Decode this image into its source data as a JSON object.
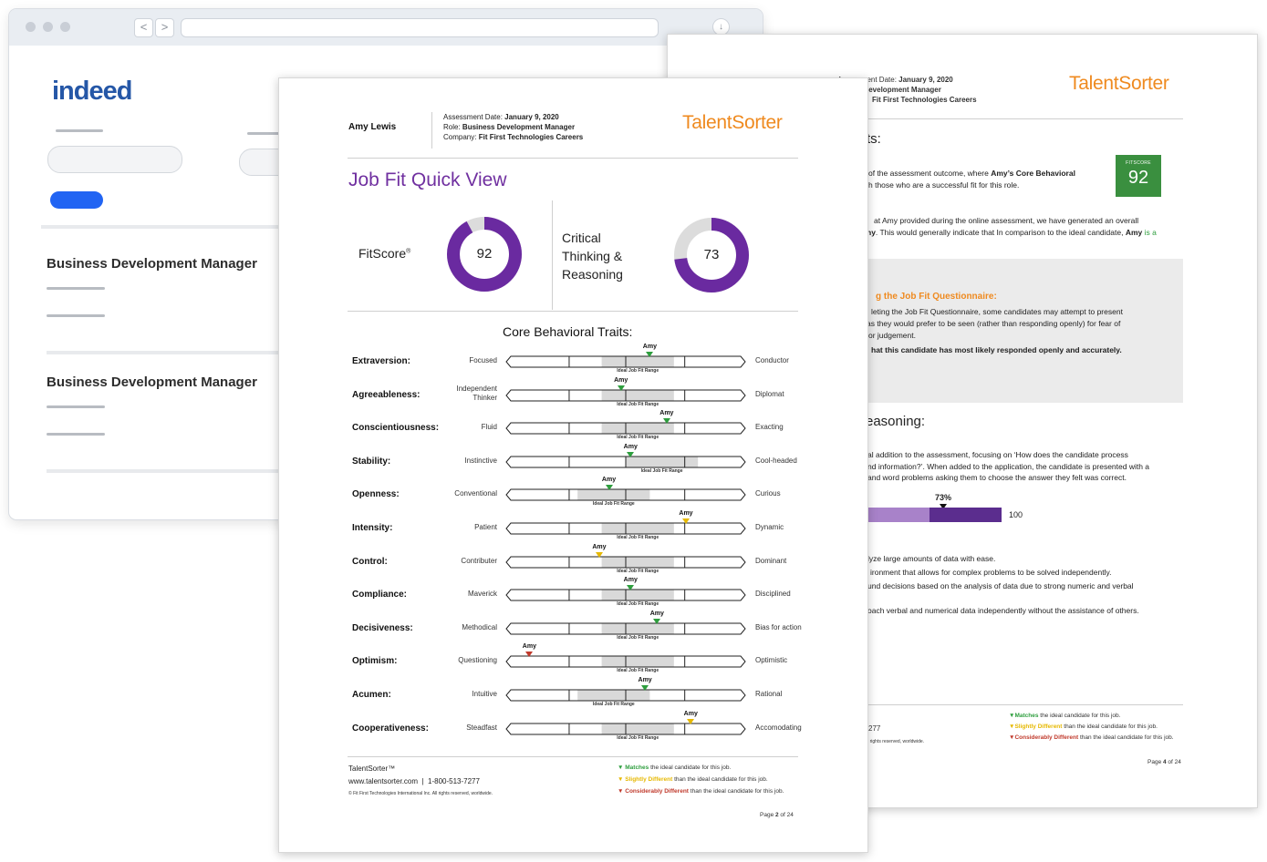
{
  "browser": {
    "logo": "indeed",
    "jobs": [
      {
        "title": "Business Development Manager"
      },
      {
        "title": "Business Development Manager"
      }
    ],
    "nav_back": "<",
    "nav_forward": ">"
  },
  "back_report": {
    "header": {
      "assessment_date_label": "Assessment Date:",
      "assessment_date": "January 9, 2020",
      "role_fragment": "ness Development Manager",
      "company_fragment": "Fit First Technologies Careers",
      "brand": "TalentSorter"
    },
    "section1_title": "ts:",
    "intro_line1_pre": "of the assessment outcome, where ",
    "intro_line1_bold": "Amy’s Core Behavioral",
    "intro_line2": "h those who are a successful fit for this role.",
    "fitscore_label": "FITSCORE",
    "fitscore_value": "92",
    "para2_line1": "at Amy provided during the online assessment, we have generated an overall",
    "para2_line2_bold1": "ny",
    "para2_line2_mid": ". This would generally indicate that In comparison to the ideal candidate, ",
    "para2_line2_bold2": "Amy",
    "para2_line2_end": " is a",
    "questionnaire_title": "g the Job Fit Questionnaire:",
    "questionnaire_line1": "leting the Job Fit Questionnaire, some candidates may attempt to present",
    "questionnaire_line2": "as they would prefer to be seen (rather than responding openly) for fear of",
    "questionnaire_line3": "or judgement.",
    "questionnaire_bold": "hat this candidate has most likely responded openly and accurately.",
    "reasoning_title": "easoning:",
    "reasoning_line1": "al addition to the assessment, focusing on ‘How does the candidate process",
    "reasoning_line2": "nd information?’. When added to the application, the candidate is presented with a",
    "reasoning_line3": " and word problems asking them to choose the answer they felt was correct.",
    "reasoning_pct_label": "73%",
    "reasoning_max": "100",
    "reasoning_pct": 73,
    "bullet1": "lyze large amounts of data with ease.",
    "bullet2": "ironment that allows for complex problems to be solved independently.",
    "bullet3": "und decisions based on the analysis of data due to strong numeric and verbal",
    "bullet4": "oach verbal and numerical data independently without the assistance of others.",
    "footer_phone_fragment": "277",
    "footer_copy_fragment": "l Inc. All rights reserved, worldwide.",
    "legend": [
      {
        "bold": "Matches",
        "rest": " the ideal candidate for this job.",
        "color": "#2e9e3e"
      },
      {
        "bold": "Slightly Different",
        "rest": " than the ideal candidate for this job.",
        "color": "#e6b800"
      },
      {
        "bold": "Considerably Different",
        "rest": " than the ideal candidate for this job.",
        "color": "#c0392b"
      }
    ],
    "page_prefix": "Page ",
    "page_num": "4",
    "page_suffix": " of 24"
  },
  "front_report": {
    "candidate": "Amy Lewis",
    "assessment_date_label": "Assessment Date:",
    "assessment_date": "January 9, 2020",
    "role_label": "Role:",
    "role": "Business Development Manager",
    "company_label": "Company:",
    "company": "Fit First Technologies Careers",
    "brand": "TalentSorter",
    "title": "Job Fit Quick View",
    "fitscore_label": "FitScore",
    "fitscore_sup": "®",
    "fitscore_value": "92",
    "fitscore_pct": 92,
    "ctr_label_l1": "Critical",
    "ctr_label_l2": "Thinking &",
    "ctr_label_l3": "Reasoning",
    "ctr_value": "73",
    "ctr_pct": 73,
    "traits_title": "Core Behavioral Traits:",
    "marker_name": "Amy",
    "range_label": "Ideal Job Fit Range",
    "traits": [
      {
        "name": "Extraversion:",
        "left": "Focused",
        "right": "Conductor",
        "range": [
          0.4,
          0.7
        ],
        "pos": 0.6,
        "status": "green"
      },
      {
        "name": "Agreeableness:",
        "left": "Independent Thinker",
        "left1": "Independent",
        "left2": "Thinker",
        "right": "Diplomat",
        "range": [
          0.4,
          0.7
        ],
        "pos": 0.48,
        "status": "green"
      },
      {
        "name": "Conscientiousness:",
        "left": "Fluid",
        "right": "Exacting",
        "range": [
          0.4,
          0.7
        ],
        "pos": 0.67,
        "status": "green"
      },
      {
        "name": "Stability:",
        "left": "Instinctive",
        "right": "Cool-headed",
        "range": [
          0.5,
          0.8
        ],
        "pos": 0.52,
        "status": "green"
      },
      {
        "name": "Openness:",
        "left": "Conventional",
        "right": "Curious",
        "range": [
          0.3,
          0.6
        ],
        "pos": 0.43,
        "status": "green"
      },
      {
        "name": "Intensity:",
        "left": "Patient",
        "right": "Dynamic",
        "range": [
          0.4,
          0.7
        ],
        "pos": 0.75,
        "status": "yellow"
      },
      {
        "name": "Control:",
        "left": "Contributer",
        "right": "Dominant",
        "range": [
          0.4,
          0.7
        ],
        "pos": 0.39,
        "status": "yellow"
      },
      {
        "name": "Compliance:",
        "left": "Maverick",
        "right": "Disciplined",
        "range": [
          0.4,
          0.7
        ],
        "pos": 0.52,
        "status": "green"
      },
      {
        "name": "Decisiveness:",
        "left": "Methodical",
        "right": "Bias for action",
        "range": [
          0.4,
          0.7
        ],
        "pos": 0.63,
        "status": "green"
      },
      {
        "name": "Optimism:",
        "left": "Questioning",
        "right": "Optimistic",
        "range": [
          0.4,
          0.7
        ],
        "pos": 0.1,
        "status": "red"
      },
      {
        "name": "Acumen:",
        "left": "Intuitive",
        "right": "Rational",
        "range": [
          0.3,
          0.6
        ],
        "pos": 0.58,
        "status": "green"
      },
      {
        "name": "Cooperativeness:",
        "left": "Steadfast",
        "right": "Accomodating",
        "range": [
          0.4,
          0.7
        ],
        "pos": 0.77,
        "status": "yellow"
      }
    ],
    "footer_brand": "TalentSorter™",
    "footer_web": "www.talentsorter.com",
    "footer_sep": "|",
    "footer_phone": "1-800-513-7277",
    "footer_copy": "© Fit First Technologies International Inc. All rights reserved, worldwide.",
    "legend": [
      {
        "bold": "Matches",
        "rest": " the ideal candidate for this job.",
        "color": "#2e9e3e"
      },
      {
        "bold": "Slightly Different",
        "rest": " than the ideal candidate for this job.",
        "color": "#e6b800"
      },
      {
        "bold": "Considerably Different",
        "rest": " than the ideal candidate for this job.",
        "color": "#c0392b"
      }
    ],
    "page_prefix": "Page ",
    "page_num": "2",
    "page_suffix": " of 24"
  },
  "colors": {
    "purple": "#7030a0",
    "orange": "#ef8a1f",
    "green_score": "#3a8f3f",
    "indeed_blue": "#2557a7"
  }
}
